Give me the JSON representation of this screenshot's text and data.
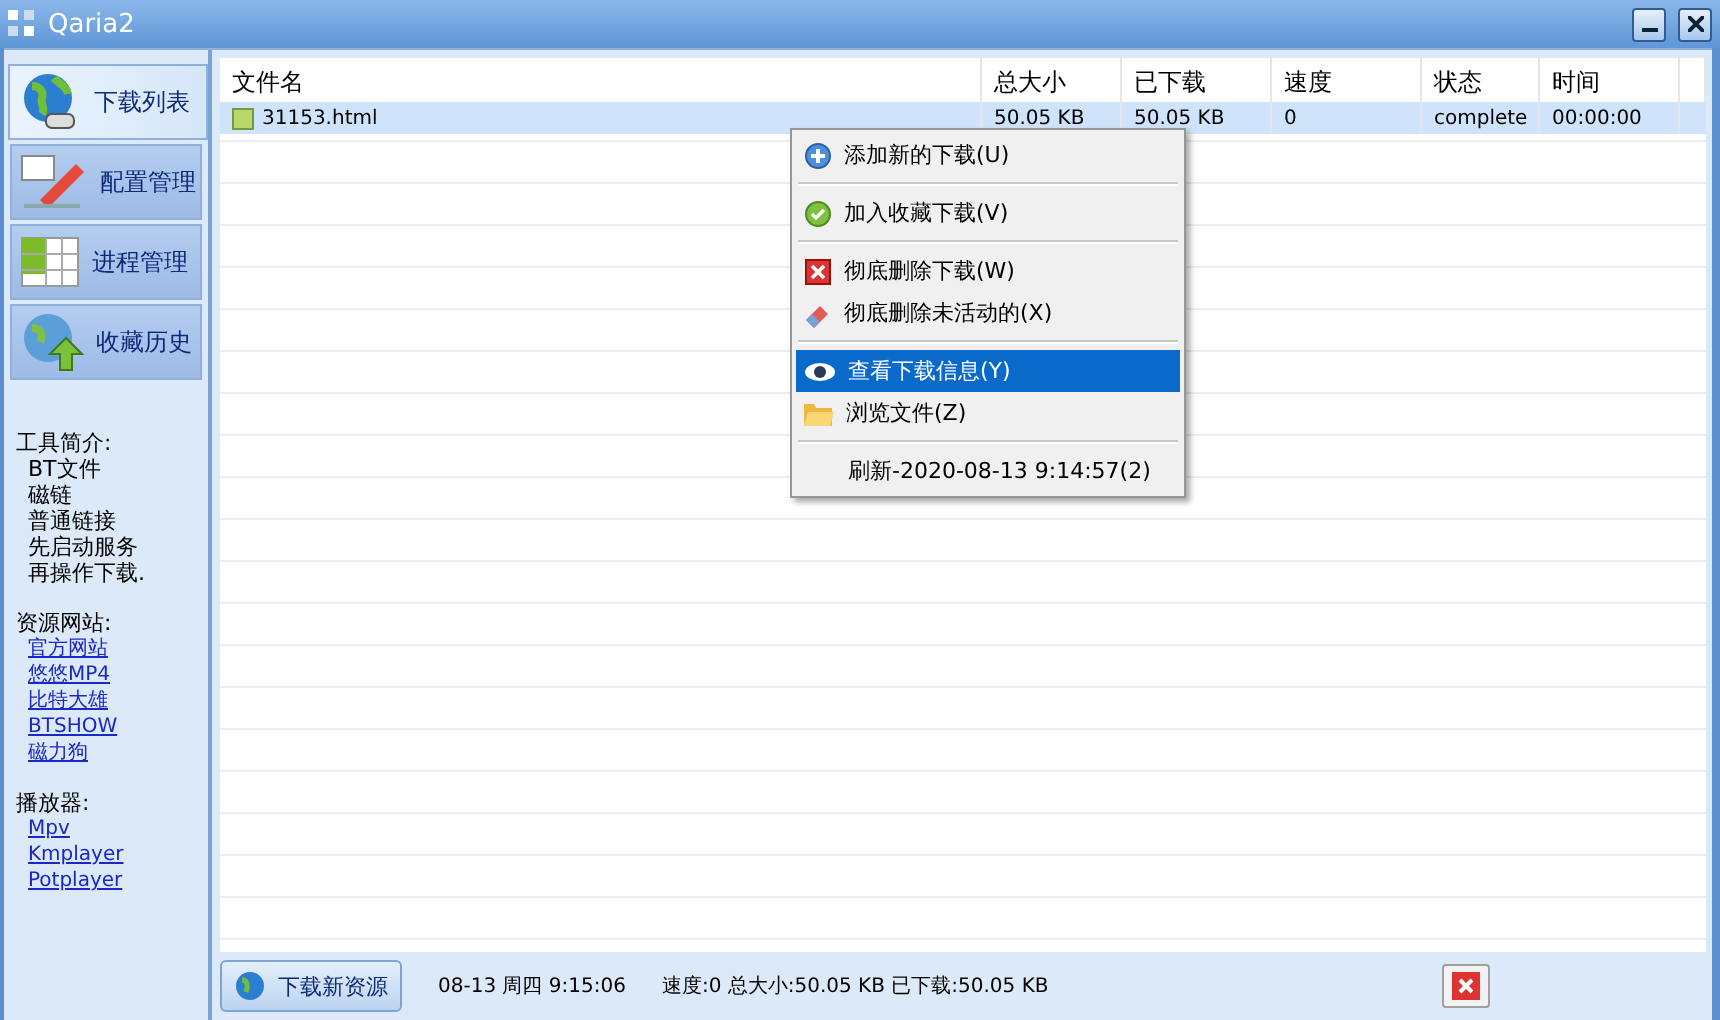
{
  "window": {
    "title": "Qaria2"
  },
  "nav": [
    {
      "label": "下载列表",
      "selected": true,
      "kind": "globe"
    },
    {
      "label": "配置管理",
      "selected": false,
      "kind": "pen"
    },
    {
      "label": "进程管理",
      "selected": false,
      "kind": "grid"
    },
    {
      "label": "收藏历史",
      "selected": false,
      "kind": "upload"
    }
  ],
  "info": [
    {
      "heading": "工具简介:",
      "kind": "text",
      "items": [
        "BT文件",
        "磁链",
        "普通链接",
        "先启动服务",
        "再操作下载."
      ]
    },
    {
      "heading": "资源网站:",
      "kind": "link",
      "items": [
        "官方网站",
        "悠悠MP4",
        "比特大雄",
        "BTSHOW",
        "磁力狗"
      ]
    },
    {
      "heading": "播放器:",
      "kind": "link",
      "items": [
        "Mpv",
        "Kmplayer",
        "Potplayer"
      ]
    }
  ],
  "table": {
    "columns": [
      "文件名",
      "总大小",
      "已下载",
      "速度",
      "状态",
      "时间"
    ],
    "rows": [
      {
        "selected": true,
        "cells": [
          "31153.html",
          "50.05 KB",
          "50.05 KB",
          "0",
          "complete",
          "00:00:00"
        ]
      }
    ]
  },
  "menu": [
    {
      "kind": "add",
      "label": "添加新的下载(U)",
      "selected": false
    },
    {
      "kind": "sep"
    },
    {
      "kind": "check",
      "label": "加入收藏下载(V)",
      "selected": false
    },
    {
      "kind": "sep"
    },
    {
      "kind": "delete",
      "label": "彻底删除下载(W)",
      "selected": false
    },
    {
      "kind": "eraser",
      "label": "彻底删除未活动的(X)",
      "selected": false
    },
    {
      "kind": "sep"
    },
    {
      "kind": "eye",
      "label": "查看下载信息(Y)",
      "selected": true
    },
    {
      "kind": "folder",
      "label": "浏览文件(Z)",
      "selected": false
    },
    {
      "kind": "sep"
    },
    {
      "kind": "plain",
      "label": "刷新-2020-08-13 9:14:57(2)",
      "selected": false
    }
  ],
  "status_bar": {
    "button": "下载新资源",
    "datetime": "08-13 周四 9:15:06",
    "summary": "速度:0 总大小:50.05 KB 已下载:50.05 KB"
  }
}
